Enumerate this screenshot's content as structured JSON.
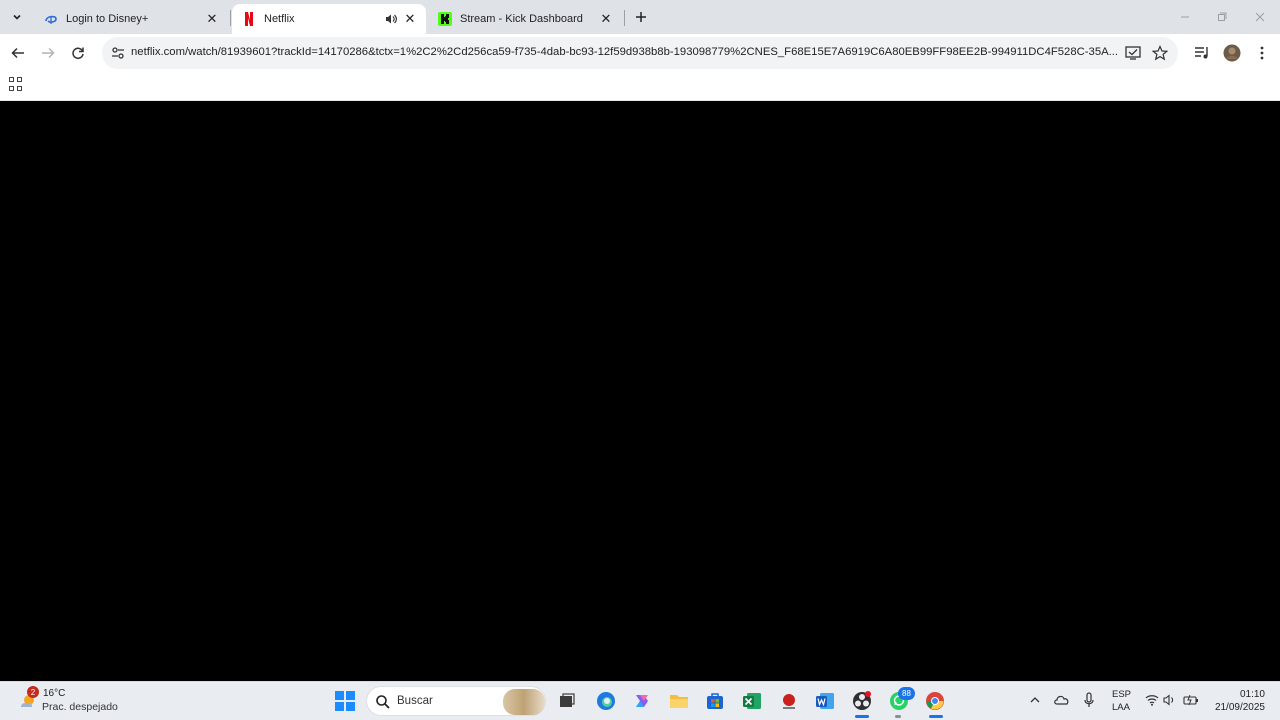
{
  "tabs": [
    {
      "title": "Login to Disney+",
      "favicon": "disney-favicon"
    },
    {
      "title": "Netflix",
      "favicon": "netflix-favicon",
      "active": true,
      "audio": true
    },
    {
      "title": "Stream - Kick Dashboard",
      "favicon": "kick-favicon"
    }
  ],
  "address": {
    "url": "netflix.com/watch/81939601?trackId=14170286&tctx=1%2C2%2Cd256ca59-f735-4dab-bc93-12f59d938b8b-193098779%2CNES_F68E15E7A6919C6A80EB99FF98EE2B-994911DC4F528C-35A..."
  },
  "weather": {
    "badge": "2",
    "temp": "16°C",
    "desc": "Prac. despejado"
  },
  "taskbar": {
    "search_label": "Buscar",
    "whatsapp_badge": "88",
    "lang_top": "ESP",
    "lang_bottom": "LAA",
    "time": "01:10",
    "date": "21/09/2025"
  },
  "colors": {
    "tabstrip": "#dfe3e8",
    "accent": "#1a73e8",
    "netflix_red": "#e50914",
    "kick_green": "#53fc18"
  }
}
